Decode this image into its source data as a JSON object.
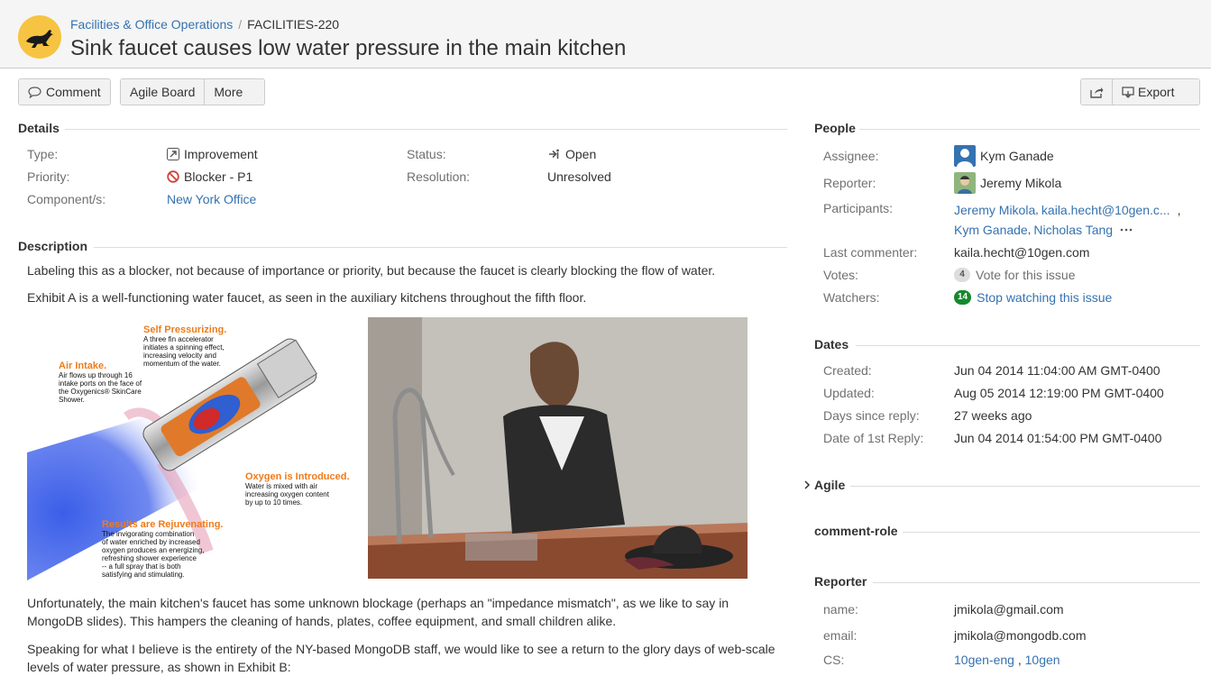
{
  "header": {
    "project": "Facilities & Office Operations",
    "separator": "/",
    "issue_key": "FACILITIES-220",
    "title": "Sink faucet causes low water pressure in the main kitchen"
  },
  "toolbar": {
    "comment": "Comment",
    "agile_board": "Agile Board",
    "more": "More",
    "export": "Export"
  },
  "details": {
    "heading": "Details",
    "type_label": "Type:",
    "type_value": "Improvement",
    "priority_label": "Priority:",
    "priority_value": "Blocker - P1",
    "components_label": "Component/s:",
    "components_value": "New York Office",
    "status_label": "Status:",
    "status_value": "Open",
    "resolution_label": "Resolution:",
    "resolution_value": "Unresolved"
  },
  "description": {
    "heading": "Description",
    "p1": "Labeling this as a blocker, not because of importance or priority, but because the faucet is clearly blocking the flow of water.",
    "p2": "Exhibit A is a well-functioning water faucet, as seen in the auxiliary kitchens throughout the fifth floor.",
    "p3": "Unfortunately, the main kitchen's faucet has some unknown blockage (perhaps an \"impedance mismatch\", as we like to say in MongoDB slides). This hampers the cleaning of hands, plates, coffee equipment, and small children alike.",
    "p4": "Speaking for what I believe is the entirety of the NY-based MongoDB staff, we would like to see a return to the glory days of web-scale levels of water pressure, as shown in Exhibit B:",
    "diagram": {
      "self_pressurizing_title": "Self Pressurizing.",
      "self_pressurizing_text": "A three fin accelerator initiates a spinning effect, increasing velocity and momentum of the water.",
      "air_intake_title": "Air Intake.",
      "air_intake_text": "Air flows up through 16 intake ports on the face of the Oxygenics® SkinCare Shower.",
      "oxygen_title": "Oxygen is Introduced.",
      "oxygen_text": "Water is mixed with air increasing oxygen content by up to 10 times.",
      "results_title": "Results are Rejuvenating.",
      "results_text": "The invigorating combination of water enriched by increased oxygen produces an energizing, refreshing shower experience -- a full spray that is both satisfying and stimulating."
    }
  },
  "people": {
    "heading": "People",
    "assignee_label": "Assignee:",
    "assignee_value": "Kym Ganade",
    "reporter_label": "Reporter:",
    "reporter_value": "Jeremy Mikola",
    "participants_label": "Participants:",
    "participant_1": "Jeremy Mikola",
    "participant_2": "kaila.hecht@10gen.c...",
    "participant_3": "Kym Ganade",
    "participant_4": "Nicholas Tang",
    "last_commenter_label": "Last commenter:",
    "last_commenter_value": "kaila.hecht@10gen.com",
    "votes_label": "Votes:",
    "votes_count": "4",
    "votes_action": "Vote for this issue",
    "watchers_label": "Watchers:",
    "watchers_count": "14",
    "watchers_action": "Stop watching this issue"
  },
  "dates": {
    "heading": "Dates",
    "created_label": "Created:",
    "created_value": "Jun 04 2014 11:04:00 AM GMT-0400",
    "updated_label": "Updated:",
    "updated_value": "Aug 05 2014 12:19:00 PM GMT-0400",
    "days_label": "Days since reply:",
    "days_value": "27 weeks ago",
    "first_reply_label": "Date of 1st Reply:",
    "first_reply_value": "Jun 04 2014 01:54:00 PM GMT-0400"
  },
  "agile": {
    "heading": "Agile"
  },
  "comment_role": {
    "heading": "comment-role"
  },
  "reporter_block": {
    "heading": "Reporter",
    "name_label": "name:",
    "name_value": "jmikola@gmail.com",
    "email_label": "email:",
    "email_value": "jmikola@mongodb.com",
    "cs_label": "CS:",
    "cs_value_1": "10gen-eng",
    "cs_value_2": "10gen"
  },
  "colors": {
    "link": "#3572b0",
    "logo": "#f6c342",
    "watch_badge": "#14892c",
    "priority": "#d04437"
  }
}
